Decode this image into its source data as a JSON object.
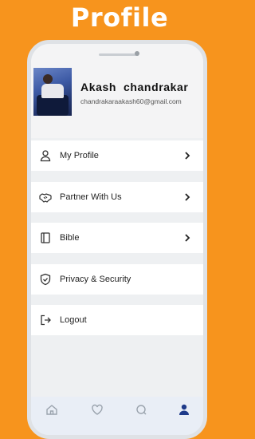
{
  "promo": {
    "title": "Profile"
  },
  "user": {
    "name": "Akash  chandrakar",
    "email": "chandrakaraakash60@gmail.com"
  },
  "menu": {
    "items": [
      {
        "label": "My Profile",
        "icon": "person-icon",
        "has_chevron": true
      },
      {
        "label": "Partner With Us",
        "icon": "handshake-icon",
        "has_chevron": true
      },
      {
        "label": "Bible",
        "icon": "book-icon",
        "has_chevron": true
      },
      {
        "label": "Privacy & Security",
        "icon": "shield-icon",
        "has_chevron": false
      },
      {
        "label": "Logout",
        "icon": "logout-icon",
        "has_chevron": false
      }
    ]
  },
  "bottom_nav": {
    "items": [
      {
        "icon": "home-icon",
        "active": false
      },
      {
        "icon": "heart-icon",
        "active": false
      },
      {
        "icon": "search-icon",
        "active": false
      },
      {
        "icon": "profile-icon",
        "active": true
      }
    ]
  },
  "colors": {
    "background": "#F7941D",
    "active_nav": "#1e3a8a",
    "inactive_nav": "#9aa3ad"
  }
}
